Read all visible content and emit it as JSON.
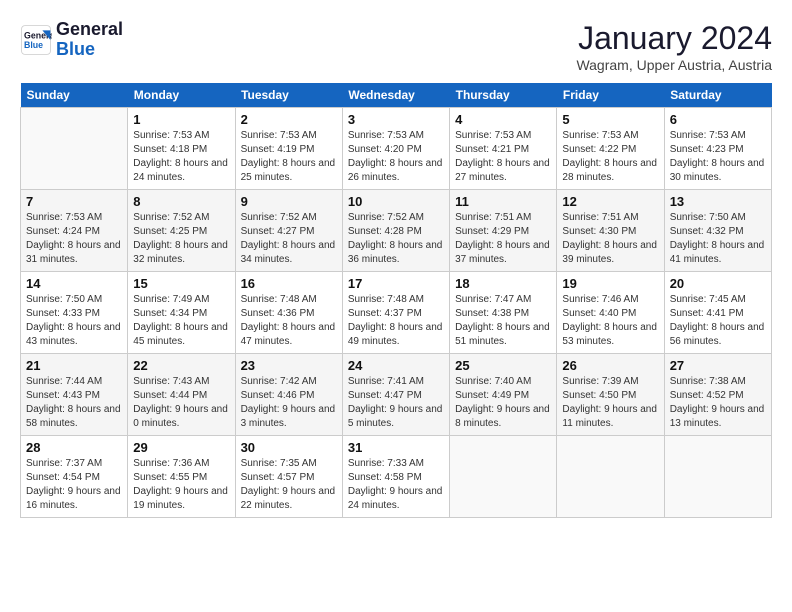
{
  "logo": {
    "line1": "General",
    "line2": "Blue"
  },
  "title": "January 2024",
  "location": "Wagram, Upper Austria, Austria",
  "weekdays": [
    "Sunday",
    "Monday",
    "Tuesday",
    "Wednesday",
    "Thursday",
    "Friday",
    "Saturday"
  ],
  "weeks": [
    [
      {
        "day": "",
        "sunrise": "",
        "sunset": "",
        "daylight": ""
      },
      {
        "day": "1",
        "sunrise": "Sunrise: 7:53 AM",
        "sunset": "Sunset: 4:18 PM",
        "daylight": "Daylight: 8 hours and 24 minutes."
      },
      {
        "day": "2",
        "sunrise": "Sunrise: 7:53 AM",
        "sunset": "Sunset: 4:19 PM",
        "daylight": "Daylight: 8 hours and 25 minutes."
      },
      {
        "day": "3",
        "sunrise": "Sunrise: 7:53 AM",
        "sunset": "Sunset: 4:20 PM",
        "daylight": "Daylight: 8 hours and 26 minutes."
      },
      {
        "day": "4",
        "sunrise": "Sunrise: 7:53 AM",
        "sunset": "Sunset: 4:21 PM",
        "daylight": "Daylight: 8 hours and 27 minutes."
      },
      {
        "day": "5",
        "sunrise": "Sunrise: 7:53 AM",
        "sunset": "Sunset: 4:22 PM",
        "daylight": "Daylight: 8 hours and 28 minutes."
      },
      {
        "day": "6",
        "sunrise": "Sunrise: 7:53 AM",
        "sunset": "Sunset: 4:23 PM",
        "daylight": "Daylight: 8 hours and 30 minutes."
      }
    ],
    [
      {
        "day": "7",
        "sunrise": "Sunrise: 7:53 AM",
        "sunset": "Sunset: 4:24 PM",
        "daylight": "Daylight: 8 hours and 31 minutes."
      },
      {
        "day": "8",
        "sunrise": "Sunrise: 7:52 AM",
        "sunset": "Sunset: 4:25 PM",
        "daylight": "Daylight: 8 hours and 32 minutes."
      },
      {
        "day": "9",
        "sunrise": "Sunrise: 7:52 AM",
        "sunset": "Sunset: 4:27 PM",
        "daylight": "Daylight: 8 hours and 34 minutes."
      },
      {
        "day": "10",
        "sunrise": "Sunrise: 7:52 AM",
        "sunset": "Sunset: 4:28 PM",
        "daylight": "Daylight: 8 hours and 36 minutes."
      },
      {
        "day": "11",
        "sunrise": "Sunrise: 7:51 AM",
        "sunset": "Sunset: 4:29 PM",
        "daylight": "Daylight: 8 hours and 37 minutes."
      },
      {
        "day": "12",
        "sunrise": "Sunrise: 7:51 AM",
        "sunset": "Sunset: 4:30 PM",
        "daylight": "Daylight: 8 hours and 39 minutes."
      },
      {
        "day": "13",
        "sunrise": "Sunrise: 7:50 AM",
        "sunset": "Sunset: 4:32 PM",
        "daylight": "Daylight: 8 hours and 41 minutes."
      }
    ],
    [
      {
        "day": "14",
        "sunrise": "Sunrise: 7:50 AM",
        "sunset": "Sunset: 4:33 PM",
        "daylight": "Daylight: 8 hours and 43 minutes."
      },
      {
        "day": "15",
        "sunrise": "Sunrise: 7:49 AM",
        "sunset": "Sunset: 4:34 PM",
        "daylight": "Daylight: 8 hours and 45 minutes."
      },
      {
        "day": "16",
        "sunrise": "Sunrise: 7:48 AM",
        "sunset": "Sunset: 4:36 PM",
        "daylight": "Daylight: 8 hours and 47 minutes."
      },
      {
        "day": "17",
        "sunrise": "Sunrise: 7:48 AM",
        "sunset": "Sunset: 4:37 PM",
        "daylight": "Daylight: 8 hours and 49 minutes."
      },
      {
        "day": "18",
        "sunrise": "Sunrise: 7:47 AM",
        "sunset": "Sunset: 4:38 PM",
        "daylight": "Daylight: 8 hours and 51 minutes."
      },
      {
        "day": "19",
        "sunrise": "Sunrise: 7:46 AM",
        "sunset": "Sunset: 4:40 PM",
        "daylight": "Daylight: 8 hours and 53 minutes."
      },
      {
        "day": "20",
        "sunrise": "Sunrise: 7:45 AM",
        "sunset": "Sunset: 4:41 PM",
        "daylight": "Daylight: 8 hours and 56 minutes."
      }
    ],
    [
      {
        "day": "21",
        "sunrise": "Sunrise: 7:44 AM",
        "sunset": "Sunset: 4:43 PM",
        "daylight": "Daylight: 8 hours and 58 minutes."
      },
      {
        "day": "22",
        "sunrise": "Sunrise: 7:43 AM",
        "sunset": "Sunset: 4:44 PM",
        "daylight": "Daylight: 9 hours and 0 minutes."
      },
      {
        "day": "23",
        "sunrise": "Sunrise: 7:42 AM",
        "sunset": "Sunset: 4:46 PM",
        "daylight": "Daylight: 9 hours and 3 minutes."
      },
      {
        "day": "24",
        "sunrise": "Sunrise: 7:41 AM",
        "sunset": "Sunset: 4:47 PM",
        "daylight": "Daylight: 9 hours and 5 minutes."
      },
      {
        "day": "25",
        "sunrise": "Sunrise: 7:40 AM",
        "sunset": "Sunset: 4:49 PM",
        "daylight": "Daylight: 9 hours and 8 minutes."
      },
      {
        "day": "26",
        "sunrise": "Sunrise: 7:39 AM",
        "sunset": "Sunset: 4:50 PM",
        "daylight": "Daylight: 9 hours and 11 minutes."
      },
      {
        "day": "27",
        "sunrise": "Sunrise: 7:38 AM",
        "sunset": "Sunset: 4:52 PM",
        "daylight": "Daylight: 9 hours and 13 minutes."
      }
    ],
    [
      {
        "day": "28",
        "sunrise": "Sunrise: 7:37 AM",
        "sunset": "Sunset: 4:54 PM",
        "daylight": "Daylight: 9 hours and 16 minutes."
      },
      {
        "day": "29",
        "sunrise": "Sunrise: 7:36 AM",
        "sunset": "Sunset: 4:55 PM",
        "daylight": "Daylight: 9 hours and 19 minutes."
      },
      {
        "day": "30",
        "sunrise": "Sunrise: 7:35 AM",
        "sunset": "Sunset: 4:57 PM",
        "daylight": "Daylight: 9 hours and 22 minutes."
      },
      {
        "day": "31",
        "sunrise": "Sunrise: 7:33 AM",
        "sunset": "Sunset: 4:58 PM",
        "daylight": "Daylight: 9 hours and 24 minutes."
      },
      {
        "day": "",
        "sunrise": "",
        "sunset": "",
        "daylight": ""
      },
      {
        "day": "",
        "sunrise": "",
        "sunset": "",
        "daylight": ""
      },
      {
        "day": "",
        "sunrise": "",
        "sunset": "",
        "daylight": ""
      }
    ]
  ]
}
